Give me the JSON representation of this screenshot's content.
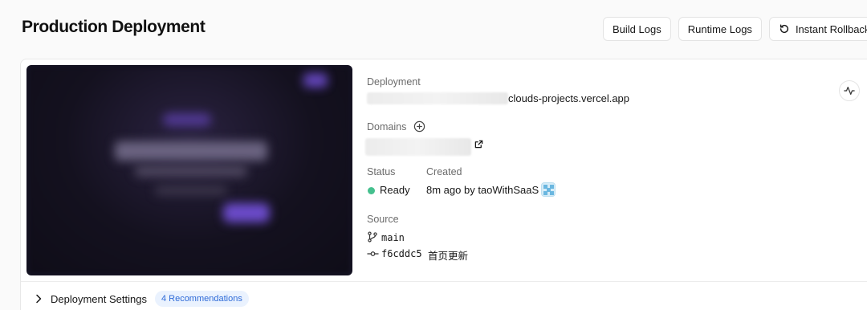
{
  "header": {
    "title": "Production Deployment",
    "buttons": {
      "build_logs": "Build Logs",
      "runtime_logs": "Runtime Logs",
      "instant_rollback": "Instant Rollback"
    }
  },
  "deployment": {
    "label": "Deployment",
    "url_suffix": "clouds-projects.vercel.app"
  },
  "domains": {
    "label": "Domains"
  },
  "status": {
    "label": "Status",
    "value": "Ready",
    "color": "#45c08e"
  },
  "created": {
    "label": "Created",
    "value": "8m ago by taoWithSaaS"
  },
  "source": {
    "label": "Source",
    "branch": "main",
    "commit_hash": "f6cddc5",
    "commit_message": "首页更新"
  },
  "settings": {
    "title": "Deployment Settings",
    "badge": "4 Recommendations",
    "badge_color": "#2f6bd8"
  }
}
